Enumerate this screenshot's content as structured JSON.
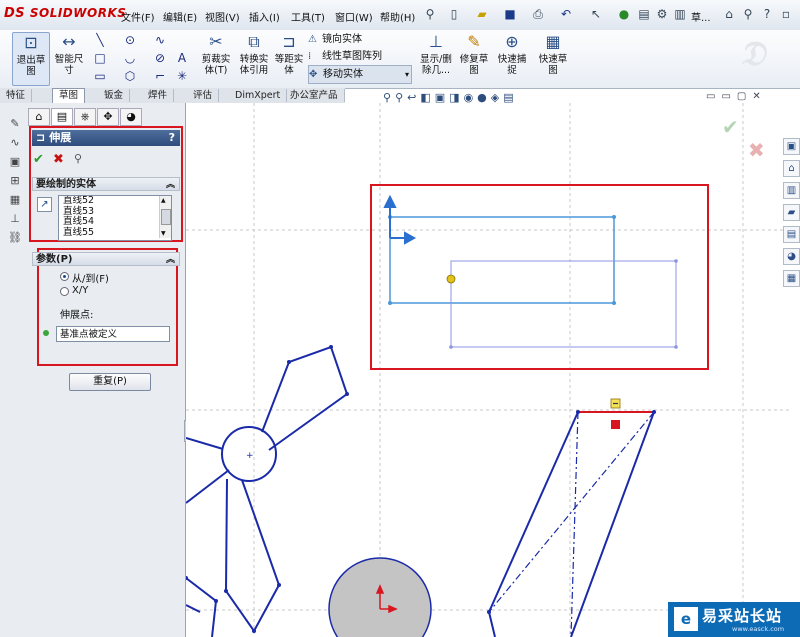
{
  "app": {
    "brand": "SOLIDWORKS",
    "brand_prefix": "DS"
  },
  "menu": [
    "文件(F)",
    "编辑(E)",
    "视图(V)",
    "插入(I)",
    "工具(T)",
    "窗口(W)",
    "帮助(H)"
  ],
  "title_trunc": "草...",
  "ribbon": {
    "exit_sketch": "退出草图",
    "smart_dimension": "智能尺寸",
    "trim": "剪裁实体(T)",
    "convert": "转换实体引用",
    "offset": "等距实体",
    "mirror": "镜向实体",
    "linear_pattern": "线性草图阵列",
    "move": "移动实体",
    "display_delete": "显示/删除几...",
    "repair": "修复草图",
    "quick_snap": "快速捕捉",
    "rapid_sketch": "快速草图"
  },
  "tabs": [
    "特征",
    "草图",
    "钣金",
    "焊件",
    "评估",
    "DimXpert",
    "办公室产品"
  ],
  "active_tab": 1,
  "pm": {
    "title": "伸展",
    "help": "?",
    "entities_heading": "要绘制的实体",
    "entities": [
      "直线52",
      "直线53",
      "直线54",
      "直线55"
    ],
    "params_heading": "参数(P)",
    "opt_from_to": "从/到(F)",
    "opt_xy": "X/Y",
    "base_point_label": "伸展点:",
    "base_point_value": "基准点被定义",
    "reset": "重复(P)"
  },
  "watermark": {
    "logo": "e",
    "text": "易采站长站",
    "url": "www.easck.com"
  },
  "colors": {
    "highlight": "#d8161f",
    "sketch": "#1a2aa8",
    "selected": "#4c97d8",
    "preview": "#8d93e3"
  }
}
